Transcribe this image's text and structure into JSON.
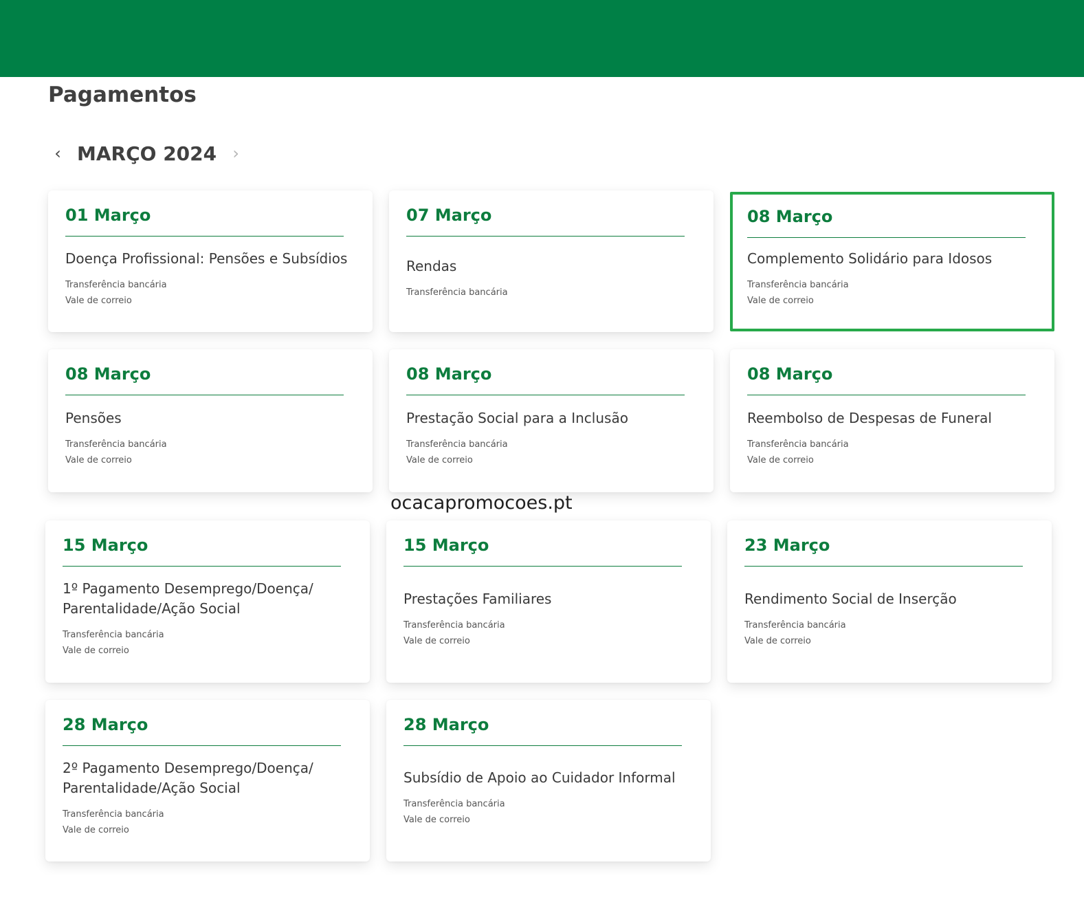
{
  "page": {
    "title": "Pagamentos"
  },
  "month_nav": {
    "label": "MARÇO 2024",
    "prev_icon": "‹",
    "next_icon": "›"
  },
  "watermark": "ocacapromocoes.pt",
  "colors": {
    "brand_green": "#008046",
    "date_green": "#0d7d3e",
    "highlight_border": "#27a94a"
  },
  "cards": [
    {
      "date": "01 Março",
      "title": "Doença Profissional: Pensões e Subsídios",
      "methods": [
        "Transferência bancária",
        "Vale de correio"
      ]
    },
    {
      "date": "07 Março",
      "title": "Rendas",
      "methods": [
        "Transferência bancária"
      ]
    },
    {
      "date": "08 Março",
      "title": "Complemento Solidário para Idosos",
      "methods": [
        "Transferência bancária",
        "Vale de correio"
      ],
      "highlighted": true
    },
    {
      "date": "08 Março",
      "title": "Pensões",
      "methods": [
        "Transferência bancária",
        "Vale de correio"
      ]
    },
    {
      "date": "08 Março",
      "title": "Prestação Social para a Inclusão",
      "methods": [
        "Transferência bancária",
        "Vale de correio"
      ]
    },
    {
      "date": "08 Março",
      "title": "Reembolso de Despesas de Funeral",
      "methods": [
        "Transferência bancária",
        "Vale de correio"
      ]
    },
    {
      "date": "15 Março",
      "title": "1º Pagamento Desemprego/Doença/ Parentalidade/Ação Social",
      "methods": [
        "Transferência bancária",
        "Vale de correio"
      ]
    },
    {
      "date": "15 Março",
      "title": "Prestações Familiares",
      "methods": [
        "Transferência bancária",
        "Vale de correio"
      ]
    },
    {
      "date": "23 Março",
      "title": "Rendimento Social de Inserção",
      "methods": [
        "Transferência bancária",
        "Vale de correio"
      ]
    },
    {
      "date": "28 Março",
      "title": "2º Pagamento Desemprego/Doença/ Parentalidade/Ação Social",
      "methods": [
        "Transferência bancária",
        "Vale de correio"
      ]
    },
    {
      "date": "28 Março",
      "title": "Subsídio de Apoio ao Cuidador Informal",
      "methods": [
        "Transferência bancária",
        "Vale de correio"
      ]
    }
  ]
}
